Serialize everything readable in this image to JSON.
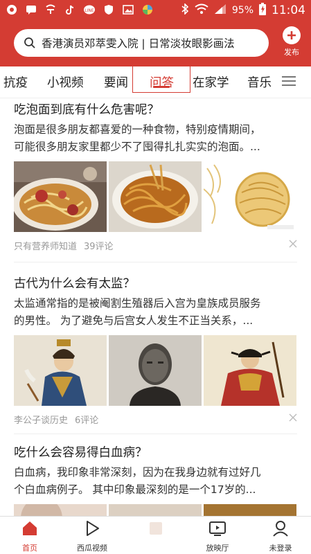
{
  "statusbar": {
    "battery": "95%",
    "time": "11:04"
  },
  "header": {
    "search_text": "香港演员邓萃雯入院 | 日常淡妆眼影画法",
    "publish_label": "发布"
  },
  "tabs": [
    {
      "label": "抗疫",
      "active": false
    },
    {
      "label": "小视频",
      "active": false
    },
    {
      "label": "要闻",
      "active": false
    },
    {
      "label": "问答",
      "active": true
    },
    {
      "label": "在家学",
      "active": false
    },
    {
      "label": "音乐",
      "active": false
    }
  ],
  "feed": [
    {
      "title": "吃泡面到底有什么危害呢？",
      "excerpt_lines": [
        "泡面是很多朋友都喜爱的一种食物，特别疫情期间，",
        "可能很多朋友家里都少不了囤得扎扎实实的泡面。..."
      ],
      "author": "只有营养师知道",
      "comments": "39评论"
    },
    {
      "title": "古代为什么会有太监？",
      "excerpt_lines": [
        "太监通常指的是被阉割生殖器后入宫为皇族成员服务",
        "的男性。 为了避免与后宫女人发生不正当关系，..."
      ],
      "author": "李公子谈历史",
      "comments": "6评论"
    },
    {
      "title": "吃什么会容易得白血病？",
      "excerpt_lines": [
        "白血病，我印象非常深刻，因为在我身边就有过好几",
        "个白血病例子。 其中印象最深刻的是一个17岁的..."
      ],
      "author": "",
      "comments": ""
    }
  ],
  "bottomnav": [
    {
      "label": "首页",
      "icon": "home-icon",
      "active": true
    },
    {
      "label": "西瓜视频",
      "icon": "play-icon",
      "active": false
    },
    {
      "label": "",
      "icon": "task-icon",
      "active": false
    },
    {
      "label": "放映厅",
      "icon": "tv-icon",
      "active": false
    },
    {
      "label": "未登录",
      "icon": "person-icon",
      "active": false
    }
  ],
  "colors": {
    "brand_red": "#d43c33",
    "text_dark": "#222222",
    "text_meta": "#999999"
  }
}
